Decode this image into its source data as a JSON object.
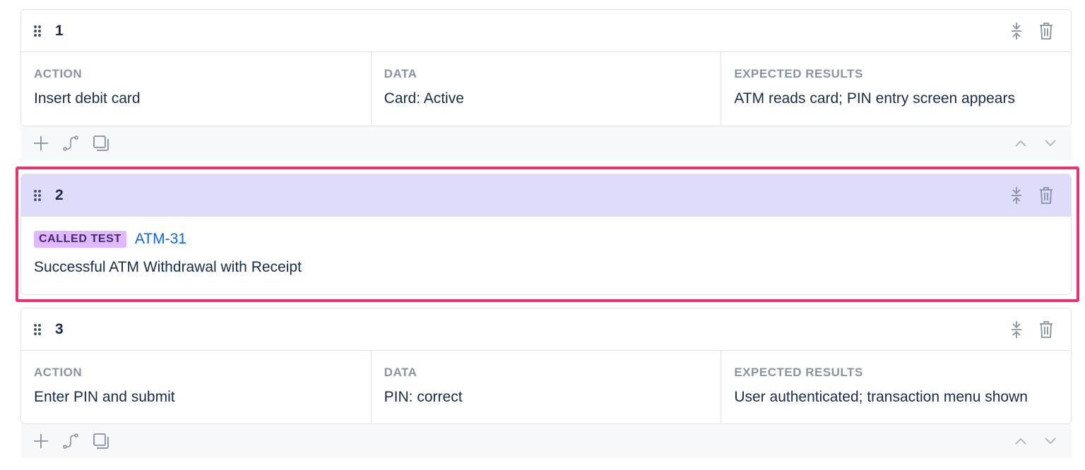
{
  "steps": [
    {
      "number": "1",
      "type": "standard",
      "columns": [
        {
          "label": "ACTION",
          "value": "Insert debit card"
        },
        {
          "label": "DATA",
          "value": "Card: Active"
        },
        {
          "label": "EXPECTED RESULTS",
          "value": "ATM reads card; PIN entry screen appears"
        }
      ]
    },
    {
      "number": "2",
      "type": "called-test",
      "badge": "CALLED TEST",
      "test_key": "ATM-31",
      "test_title": "Successful ATM Withdrawal with Receipt",
      "highlighted": true,
      "header_color": "#dedcfa"
    },
    {
      "number": "3",
      "type": "standard",
      "columns": [
        {
          "label": "ACTION",
          "value": "Enter PIN and submit"
        },
        {
          "label": "DATA",
          "value": "PIN: correct"
        },
        {
          "label": "EXPECTED RESULTS",
          "value": "User authenticated; transaction menu shown"
        }
      ]
    }
  ],
  "icons": {
    "drag": "drag-handle-icon",
    "collapse": "collapse-icon",
    "delete": "trash-icon",
    "add": "plus-icon",
    "call": "call-test-icon",
    "clone": "clone-icon",
    "up": "chevron-up-icon",
    "down": "chevron-down-icon"
  },
  "colors": {
    "highlight_border": "#e8336d",
    "badge_bg": "#dfb8ff",
    "link": "#0c66e4"
  }
}
